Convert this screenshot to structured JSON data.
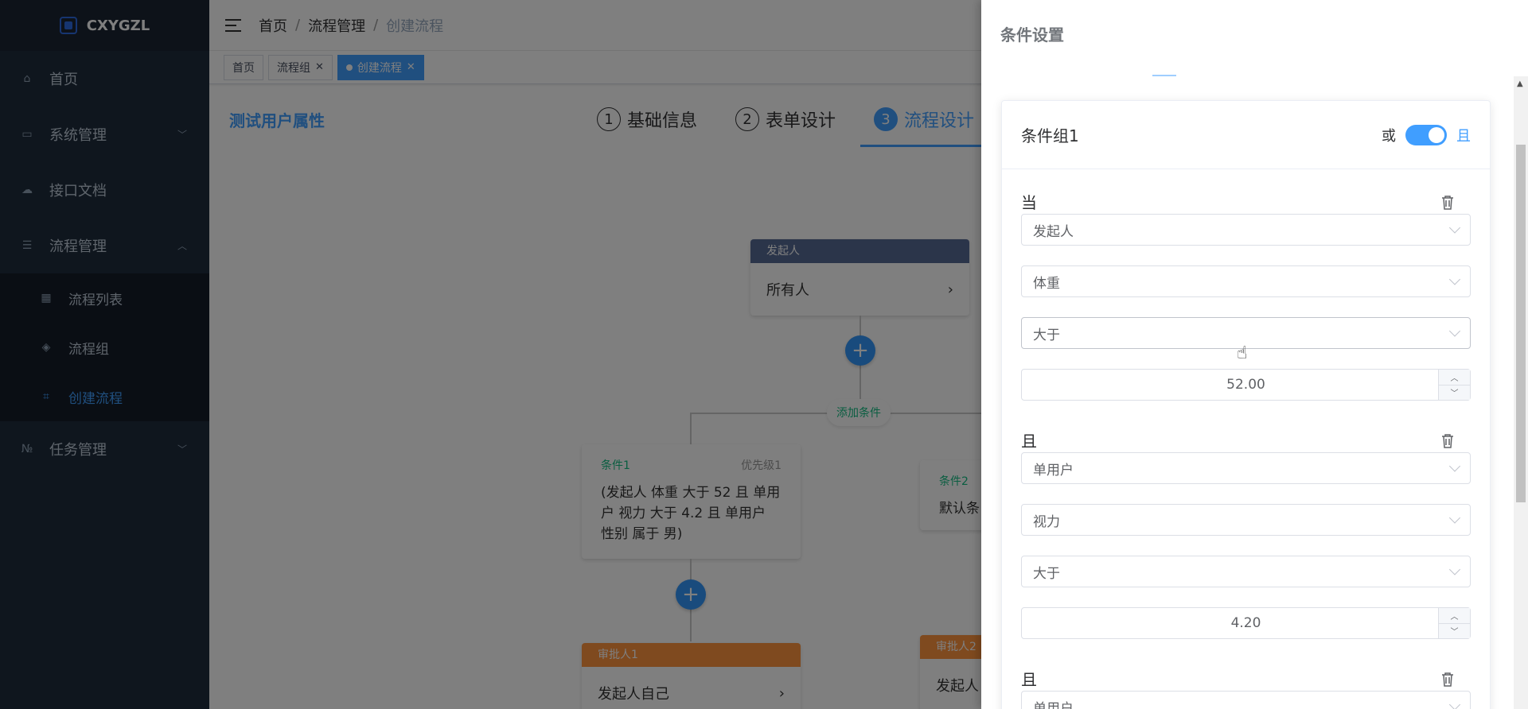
{
  "app": {
    "logo_text": "CXYGZL"
  },
  "sidebar": {
    "items": [
      {
        "label": "首页",
        "icon": "home-icon"
      },
      {
        "label": "系统管理",
        "icon": "monitor-icon"
      },
      {
        "label": "接口文档",
        "icon": "cloud-icon"
      },
      {
        "label": "流程管理",
        "icon": "tree-icon"
      },
      {
        "label": "任务管理",
        "icon": "number-icon"
      }
    ],
    "submenu": [
      {
        "label": "流程列表",
        "icon": "grid-icon"
      },
      {
        "label": "流程组",
        "icon": "layers-icon"
      },
      {
        "label": "创建流程",
        "icon": "org-icon"
      }
    ]
  },
  "navbar": {
    "breadcrumb": [
      "首页",
      "流程管理",
      "创建流程"
    ]
  },
  "tags": [
    {
      "label": "首页"
    },
    {
      "label": "流程组"
    },
    {
      "label": "创建流程"
    }
  ],
  "flow": {
    "title": "测试用户属性",
    "steps": [
      {
        "num": "1",
        "label": "基础信息"
      },
      {
        "num": "2",
        "label": "表单设计"
      },
      {
        "num": "3",
        "label": "流程设计"
      }
    ],
    "starter": {
      "header": "发起人",
      "body": "所有人"
    },
    "add_condition": "添加条件",
    "cond1": {
      "name": "条件1",
      "priority": "优先级1",
      "body": "(发起人 体重 大于 52 且 单用户 视力 大于 4.2 且 单用户 性别 属于 男)"
    },
    "cond2": {
      "name": "条件2",
      "body": "默认条"
    },
    "approver1": {
      "header": "审批人1",
      "body": "发起人自己"
    },
    "approver2": {
      "header": "审批人2",
      "body": "发起人"
    }
  },
  "drawer": {
    "title": "条件设置",
    "group_title": "条件组1",
    "switch_off_label": "或",
    "switch_on_label": "且",
    "rules": [
      {
        "label": "当",
        "field1": "发起人",
        "field2": "体重",
        "operator": "大于",
        "value": "52.00"
      },
      {
        "label": "且",
        "field1": "单用户",
        "field2": "视力",
        "operator": "大于",
        "value": "4.20"
      },
      {
        "label": "且",
        "field1": "单用户"
      }
    ]
  }
}
